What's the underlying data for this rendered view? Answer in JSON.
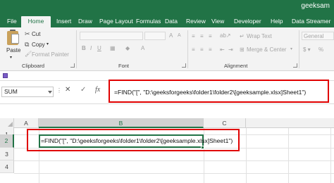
{
  "window": {
    "title": "geeksam"
  },
  "tabs": [
    "File",
    "Home",
    "Insert",
    "Draw",
    "Page Layout",
    "Formulas",
    "Data",
    "Review",
    "View",
    "Developer",
    "Help",
    "Data Streamer"
  ],
  "active_tab": "Home",
  "clipboard": {
    "paste_label": "Paste",
    "cut_label": "Cut",
    "copy_label": "Copy",
    "format_painter_label": "Format Painter",
    "group_label": "Clipboard"
  },
  "font_group": {
    "group_label": "Font"
  },
  "alignment": {
    "wrap_text_label": "Wrap Text",
    "merge_label": "Merge & Center",
    "group_label": "Alignment"
  },
  "number": {
    "format_value": "General"
  },
  "formula_bar": {
    "name_box": "SUM",
    "cancel_symbol": "✕",
    "enter_symbol": "✓",
    "fx_symbol": "fx",
    "formula": "=FIND(\"[\", \"D:\\geeksforgeeks\\folder1\\folder2\\[geeksample.xlsx]Sheet1\")"
  },
  "grid": {
    "columns": [
      "A",
      "B",
      "C"
    ],
    "rows": [
      "1",
      "2",
      "3",
      "4"
    ],
    "active_cell_text": "=FIND(\"[\", \"D:\\geeksforgeeks\\folder1\\folder2\\[geeksample.xlsx]Sheet1\")"
  },
  "colors": {
    "accent": "#217346",
    "highlight": "#e00000"
  }
}
